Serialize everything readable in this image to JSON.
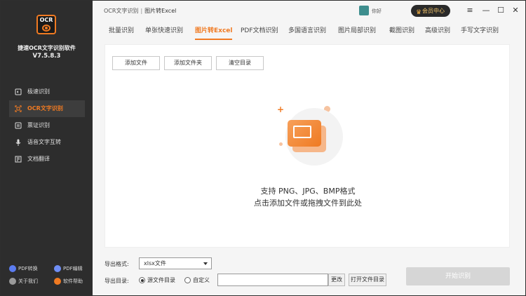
{
  "app": {
    "logo_text": "OCR",
    "name": "捷速OCR文字识别软件",
    "version": "V7.5.8.3"
  },
  "sidebar": {
    "items": [
      {
        "label": "极速识别",
        "icon": "speed-icon",
        "active": false
      },
      {
        "label": "OCR文字识别",
        "icon": "scan-icon",
        "active": true
      },
      {
        "label": "票证识别",
        "icon": "ticket-icon",
        "active": false
      },
      {
        "label": "语音文字互转",
        "icon": "mic-icon",
        "active": false
      },
      {
        "label": "文档翻译",
        "icon": "translate-icon",
        "active": false
      }
    ],
    "bottom_links": [
      {
        "label": "PDF转换",
        "icon": "pdf-convert-icon"
      },
      {
        "label": "PDF编辑",
        "icon": "pdf-edit-icon"
      },
      {
        "label": "关于我们",
        "icon": "about-icon"
      },
      {
        "label": "软件帮助",
        "icon": "help-icon"
      }
    ]
  },
  "titlebar": {
    "breadcrumb_root": "OCR文字识别",
    "breadcrumb_sep": "|",
    "breadcrumb_current": "图片转Excel",
    "user_name": "你好",
    "vip_label": "会员中心",
    "minimize": "—",
    "maximize": "☐",
    "close": "✕"
  },
  "tabs": [
    {
      "label": "批量识别",
      "active": false
    },
    {
      "label": "单张快速识别",
      "active": false
    },
    {
      "label": "图片转Excel",
      "active": true
    },
    {
      "label": "PDF文档识别",
      "active": false
    },
    {
      "label": "多国语言识别",
      "active": false
    },
    {
      "label": "图片局部识别",
      "active": false
    },
    {
      "label": "截图识别",
      "active": false
    },
    {
      "label": "高级识别",
      "active": false
    },
    {
      "label": "手写文字识别",
      "active": false
    }
  ],
  "toolbar": {
    "add_file": "添加文件",
    "add_folder": "添加文件夹",
    "clear": "清空目录"
  },
  "dropzone": {
    "plus": "+",
    "hint_formats": "支持 PNG、JPG、BMP格式",
    "hint_action": "点击添加文件或拖拽文件到此处"
  },
  "export": {
    "format_label": "导出格式:",
    "format_value": "xlsx文件",
    "dir_label": "导出目录:",
    "radio_source": "源文件目录",
    "radio_custom": "自定义",
    "selected_dir": "source",
    "path_value": "",
    "change_button": "更改",
    "open_dir_button": "打开文件目录",
    "start_button": "开始识别"
  },
  "colors": {
    "accent": "#f07a22",
    "sidebar_bg": "#2d2d2d",
    "start_disabled": "#d6d6d6"
  }
}
